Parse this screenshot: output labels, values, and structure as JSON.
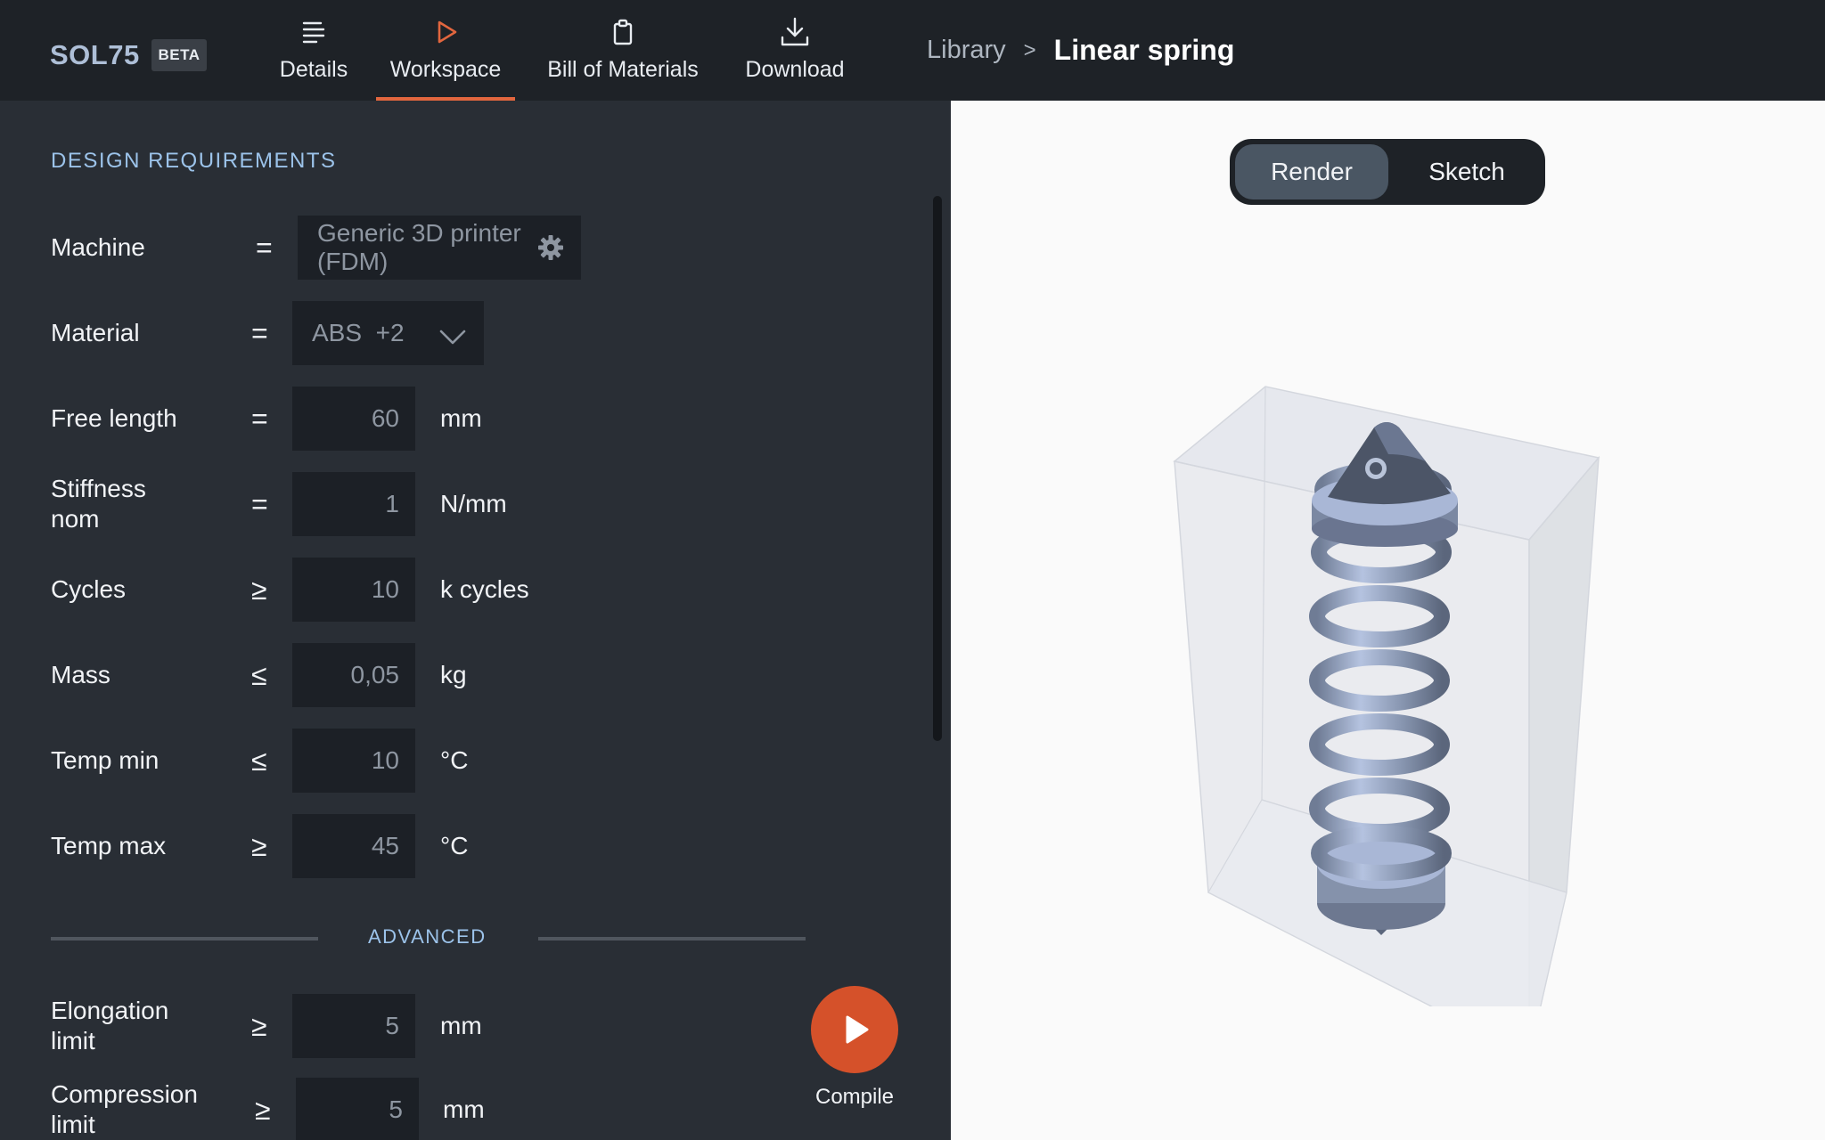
{
  "app": {
    "logo": "SOL75",
    "badge": "BETA"
  },
  "nav": [
    {
      "label": "Details",
      "icon": "details-list-icon",
      "active": false
    },
    {
      "label": "Workspace",
      "icon": "play-outline-icon",
      "active": true
    },
    {
      "label": "Bill of Materials",
      "icon": "clipboard-icon",
      "active": false
    },
    {
      "label": "Download",
      "icon": "download-icon",
      "active": false
    }
  ],
  "breadcrumb": {
    "parent": "Library",
    "separator": ">",
    "current": "Linear spring"
  },
  "requirements": {
    "title": "DESIGN REQUIREMENTS",
    "machine": {
      "label": "Machine",
      "op": "=",
      "value": "Generic 3D printer (FDM)"
    },
    "material": {
      "label": "Material",
      "op": "=",
      "value": "ABS  +2"
    },
    "fields": [
      {
        "label": "Free length",
        "op": "=",
        "value": "60",
        "unit": "mm"
      },
      {
        "label": "Stiffness nom",
        "op": "=",
        "value": "1",
        "unit": "N/mm"
      },
      {
        "label": "Cycles",
        "op": "≥",
        "value": "10",
        "unit": "k cycles"
      },
      {
        "label": "Mass",
        "op": "≤",
        "value": "0,05",
        "unit": "kg"
      },
      {
        "label": "Temp min",
        "op": "≤",
        "value": "10",
        "unit": "°C"
      },
      {
        "label": "Temp max",
        "op": "≥",
        "value": "45",
        "unit": "°C"
      }
    ],
    "advanced_title": "ADVANCED",
    "advanced": [
      {
        "label": "Elongation limit",
        "op": "≥",
        "value": "5",
        "unit": "mm"
      },
      {
        "label": "Compression limit",
        "op": "≥",
        "value": "5",
        "unit": "mm"
      }
    ]
  },
  "compile": {
    "label": "Compile"
  },
  "viewer": {
    "modes": [
      "Render",
      "Sketch"
    ],
    "active_mode": "Render"
  },
  "colors": {
    "accent": "#e2663e",
    "compile": "#d5512a",
    "link": "#9cc3ea",
    "spring": "#a9b7d6"
  }
}
